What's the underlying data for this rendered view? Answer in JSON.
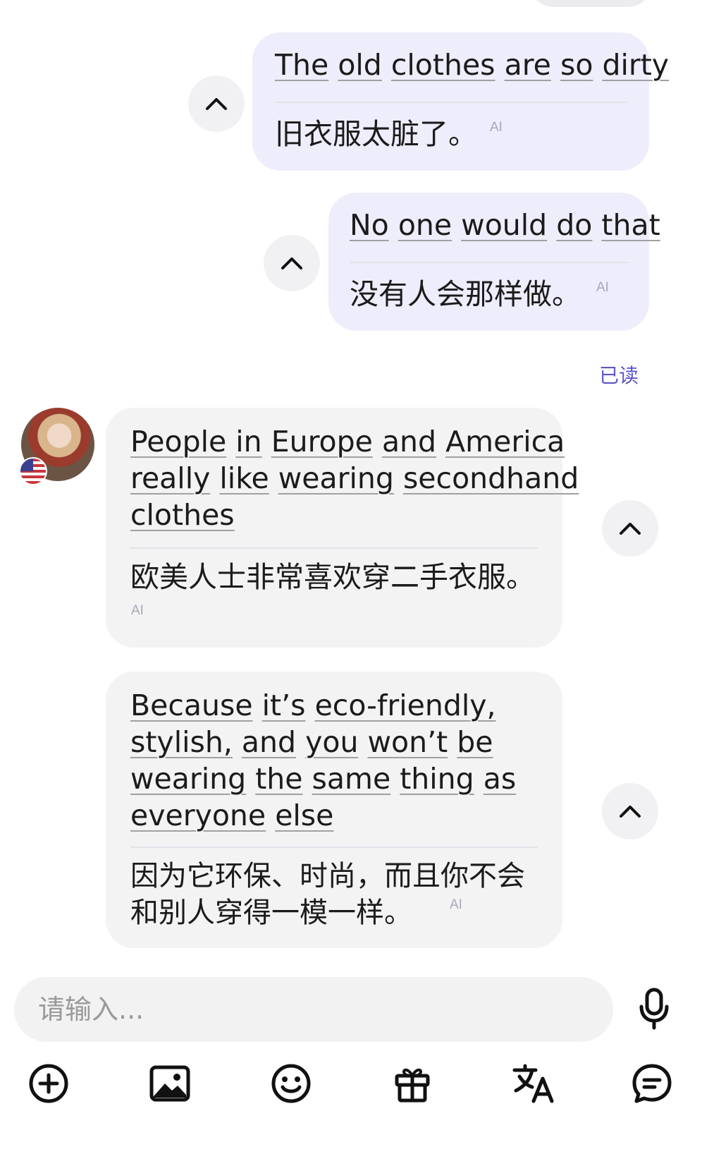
{
  "messages": [
    {
      "direction": "outgoing",
      "original_words": [
        "The",
        "old",
        "clothes",
        "are",
        "so",
        "dirty"
      ],
      "translation": "旧衣服太脏了。",
      "ai_tag": "AI"
    },
    {
      "direction": "outgoing",
      "original_words": [
        "No",
        "one",
        "would",
        "do",
        "that"
      ],
      "translation": "没有人会那样做。",
      "ai_tag": "AI"
    },
    {
      "direction": "incoming",
      "original_lines": [
        [
          "People",
          "in",
          "Europe",
          "and",
          "America"
        ],
        [
          "really",
          "like",
          "wearing",
          "secondhand"
        ],
        [
          "clothes"
        ]
      ],
      "translation": "欧美人士非常喜欢穿二手衣服。",
      "ai_tag": "AI"
    },
    {
      "direction": "incoming",
      "original_lines": [
        [
          "Because",
          "it’s",
          "eco-friendly,"
        ],
        [
          "stylish,",
          "and",
          "you",
          "won’t",
          "be"
        ],
        [
          "wearing",
          "the",
          "same",
          "thing",
          "as"
        ],
        [
          "everyone",
          "else"
        ]
      ],
      "translation_lines": [
        "因为它环保、时尚，而且你不会",
        "和别人穿得一模一样。"
      ],
      "ai_tag": "AI"
    }
  ],
  "read_status": "已读",
  "contact": {
    "avatar_icon": "avatar-photo",
    "flag_icon": "us-flag-icon"
  },
  "composer": {
    "placeholder": "请输入..."
  },
  "icons": {
    "collapse": "chevron-up-icon",
    "mic": "microphone-icon",
    "add": "plus-circle-icon",
    "image": "image-icon",
    "emoji": "smiley-icon",
    "gift": "gift-icon",
    "translate": "translate-icon",
    "chat": "chat-bubble-icon"
  },
  "colors": {
    "outgoing_bubble": "#eeedfb",
    "incoming_bubble": "#f3f3f4",
    "read_status": "#5c56c6"
  }
}
